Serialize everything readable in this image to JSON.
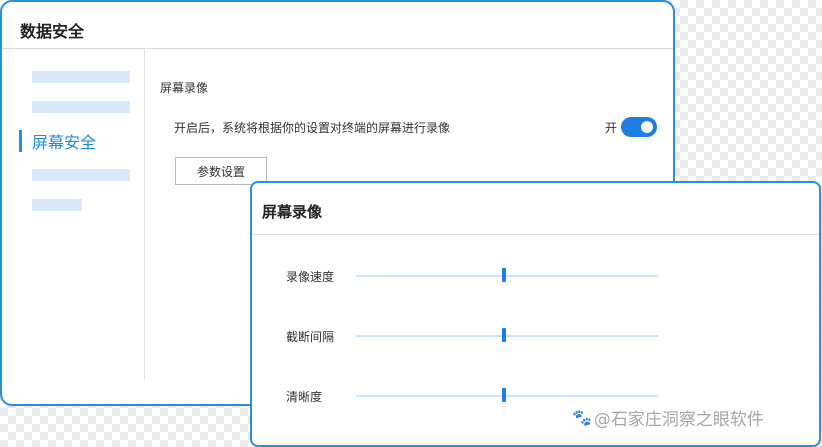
{
  "main_window": {
    "title": "数据安全",
    "sidebar": {
      "active_item": "屏幕安全"
    },
    "content": {
      "heading": "屏幕录像",
      "description": "开启后，系统将根据你的设置对终端的屏幕进行录像",
      "toggle_label": "开",
      "toggle_on": true,
      "button_label": "参数设置"
    }
  },
  "dialog": {
    "title": "屏幕录像",
    "sliders": [
      {
        "label": "录像速度",
        "value": 0.49
      },
      {
        "label": "截断间隔",
        "value": 0.49
      },
      {
        "label": "清晰度",
        "value": 0.49
      }
    ]
  },
  "watermark": {
    "text": "@石家庄洞察之眼软件",
    "icon": "paw-icon"
  },
  "colors": {
    "accent": "#1f7fe0",
    "border": "#2a8fd6",
    "sidebar_placeholder": "#d8eafb",
    "slider_track": "#cfe4f7"
  }
}
